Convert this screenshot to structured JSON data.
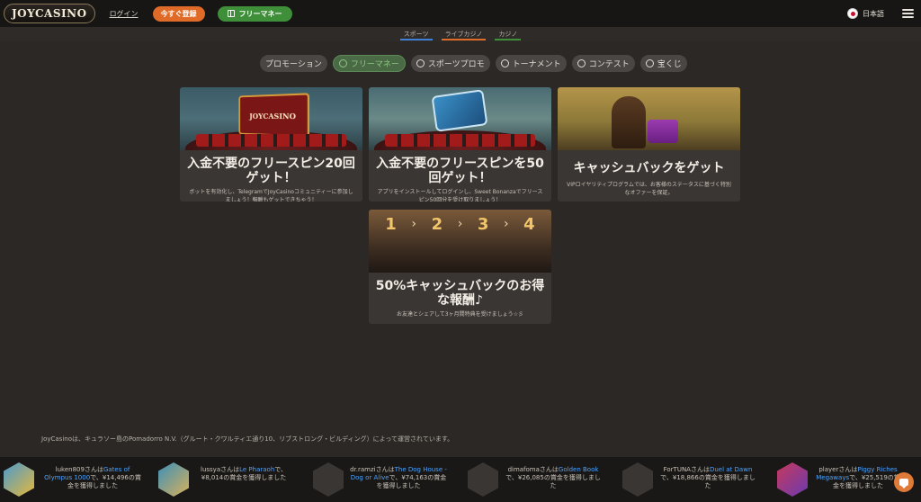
{
  "header": {
    "logo": "JOYCASINO",
    "login_label": "ログイン",
    "register_label": "今すぐ登録",
    "freemoney_label": "フリーマネー",
    "language": "日本語",
    "icons": {
      "freemoney": "gift-icon",
      "flag": "japan-flag-icon",
      "menu": "hamburger-menu-icon"
    }
  },
  "categories": [
    {
      "label": "スポーツ",
      "color": "#3f7fd6"
    },
    {
      "label": "ライブカジノ",
      "color": "#e06a28"
    },
    {
      "label": "カジノ",
      "color": "#3f8f3a"
    }
  ],
  "filters": [
    {
      "label": "プロモーション",
      "icon": "",
      "active": false
    },
    {
      "label": "フリーマネー",
      "icon": "gift-icon",
      "active": true
    },
    {
      "label": "スポーツプロモ",
      "icon": "ball-icon",
      "active": false
    },
    {
      "label": "トーナメント",
      "icon": "trophy-icon",
      "active": false
    },
    {
      "label": "コンテスト",
      "icon": "pin-icon",
      "active": false
    },
    {
      "label": "宝くじ",
      "icon": "ticket-icon",
      "active": false
    }
  ],
  "cards": [
    {
      "title": "入金不要のフリースピン20回ゲット！",
      "desc": "ボットを有効化し、TelegramでJoyCasinoコミュニティーに参加しましょう！報酬もゲットできちゃう！",
      "image_label": "JOYCASINO"
    },
    {
      "title": "入金不要のフリースピンを50回ゲット！",
      "desc": "アプリをインストールしてログインし、Sweet Bonanzaでフリースピン50回分を受け取りましょう！"
    },
    {
      "title": "キャッシュバックをゲット",
      "desc": "VIPロイヤリティプログラムでは、お客様のステータスに基づく特別なオファーを保証。"
    },
    {
      "title": "50%キャッシュバックのお得な報酬♪",
      "desc": "お友達とシェアして3ヶ月間特典を受けましょう☆彡",
      "steps": [
        "1",
        "2",
        "3",
        "4"
      ]
    }
  ],
  "footer_note": "JoyCasinoは、キュラソー島のPomadorro N.V.（グルート・クワルティエ通り10、リブストロング・ビルディング）によって運営されています。",
  "winners": [
    {
      "user": "luken809さんは",
      "game": "Gates of Olympus 1000",
      "rest": "で、¥14,496の賞金を獲得しました",
      "thumb": "g1"
    },
    {
      "user": "lussyaさんは",
      "game": "Le Pharaoh",
      "rest": "で、¥8,014の賞金を獲得しました",
      "thumb": "g2"
    },
    {
      "user": "dr.ramziさんは",
      "game": "The Dog House - Dog or Alive",
      "rest": "で、¥74,163の賞金を獲得しました",
      "thumb": ""
    },
    {
      "user": "dimafomaさんは",
      "game": "Golden Book",
      "rest": "で、¥26,085の賞金を獲得しました",
      "thumb": ""
    },
    {
      "user": "ForTUNAさんは",
      "game": "Duel at Dawn",
      "rest": "で、¥18,866の賞金を獲得しました",
      "thumb": ""
    },
    {
      "user": "playerさんは",
      "game": "Piggy Riches Megaways",
      "rest": "で、¥25,519の賞金を獲得しました",
      "thumb": "g3"
    }
  ],
  "chat_icon": "chat-icon"
}
